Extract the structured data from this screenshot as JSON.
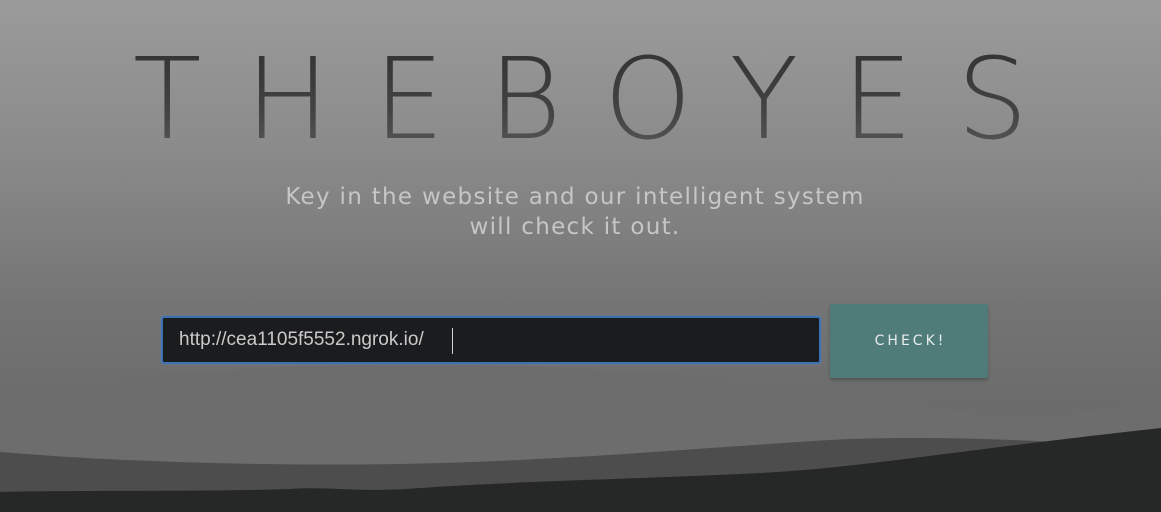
{
  "brand": {
    "title": "THEBOYES"
  },
  "hero": {
    "tagline_line1": "Key in the website and our intelligent system",
    "tagline_line2": "will check it out."
  },
  "url_form": {
    "input_value": "http://cea1105f5552.ngrok.io/",
    "submit_label": "CHECK!"
  },
  "colors": {
    "background_top": "#9b9b9b",
    "background_bottom": "#636363",
    "input_background": "#1b1c1e",
    "input_focus_border": "#3e6fb3",
    "button_background": "#4f7b79",
    "tagline_text": "#c6c6c6"
  }
}
